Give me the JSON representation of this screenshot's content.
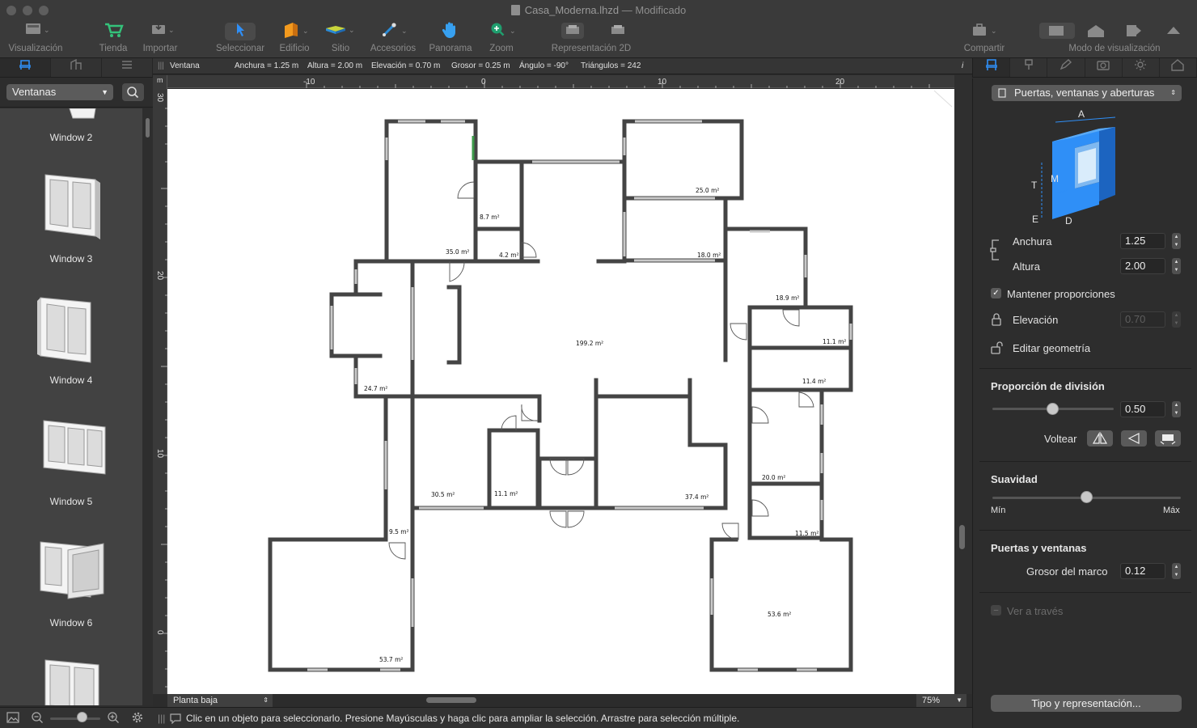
{
  "window": {
    "filename": "Casa_Moderna.lhzd",
    "status": "— Modificado"
  },
  "toolbar": {
    "visualizacion": "Visualización",
    "tienda": "Tienda",
    "importar": "Importar",
    "seleccionar": "Seleccionar",
    "edificio": "Edificio",
    "sitio": "Sitio",
    "accesorios": "Accesorios",
    "panorama": "Panorama",
    "zoom": "Zoom",
    "representacion2d": "Representación 2D",
    "compartir": "Compartir",
    "modo_visualizacion": "Modo de visualización",
    "accent_color": "#0a84ff"
  },
  "library": {
    "category": "Ventanas",
    "items": [
      {
        "label": "Window 2"
      },
      {
        "label": "Window 3"
      },
      {
        "label": "Window 4"
      },
      {
        "label": "Window 5"
      },
      {
        "label": "Window 6"
      }
    ]
  },
  "infobar": {
    "object": "Ventana",
    "anchura": "Anchura = 1.25 m",
    "altura": "Altura = 2.00 m",
    "elevacion": "Elevación = 0.70 m",
    "grosor": "Grosor = 0.25 m",
    "angulo": "Ángulo = -90°",
    "triangulos": "Triángulos = 242",
    "info_icon": "i"
  },
  "rulers": {
    "unit": "m",
    "top_ticks": [
      "-10",
      "0",
      "10",
      "20"
    ],
    "left_ticks": [
      "30",
      "20",
      "10",
      "0"
    ]
  },
  "plan": {
    "areas": [
      {
        "label": "35.0 m²"
      },
      {
        "label": "8.7 m²"
      },
      {
        "label": "4.2 m²"
      },
      {
        "label": "25.0 m²"
      },
      {
        "label": "18.0 m²"
      },
      {
        "label": "18.9 m²"
      },
      {
        "label": "11.1 m²"
      },
      {
        "label": "11.4 m²"
      },
      {
        "label": "199.2 m²"
      },
      {
        "label": "24.7 m²"
      },
      {
        "label": "30.5 m²"
      },
      {
        "label": "11.1 m²"
      },
      {
        "label": "37.4 m²"
      },
      {
        "label": "20.0 m²"
      },
      {
        "label": "11.5 m²"
      },
      {
        "label": "9.5 m²"
      },
      {
        "label": "53.7 m²"
      },
      {
        "label": "53.6 m²"
      }
    ]
  },
  "floorbar": {
    "floor": "Planta baja",
    "zoom": "75%"
  },
  "status": {
    "message": "Clic en un objeto para seleccionarlo. Presione Mayúsculas y haga clic para ampliar la selección. Arrastre para selección múltiple."
  },
  "inspector": {
    "category": "Puertas, ventanas y aberturas",
    "diagram_labels": {
      "a": "A",
      "t": "T",
      "m": "M",
      "e": "E",
      "d": "D"
    },
    "anchura_label": "Anchura",
    "anchura_value": "1.25",
    "altura_label": "Altura",
    "altura_value": "2.00",
    "mantener_label": "Mantener proporciones",
    "mantener_checked": true,
    "elevacion_label": "Elevación",
    "elevacion_value": "0.70",
    "editar_label": "Editar geometría",
    "proporcion_header": "Proporción de división",
    "proporcion_value": "0.50",
    "proporcion_level": 0.5,
    "voltear_label": "Voltear",
    "suavidad_header": "Suavidad",
    "suavidad_level": 0.5,
    "min_label": "Mín",
    "max_label": "Máx",
    "puertas_header": "Puertas y ventanas",
    "grosor_label": "Grosor del marco",
    "grosor_value": "0.12",
    "ver_label": "Ver a través",
    "tipo_button": "Tipo y representación..."
  }
}
